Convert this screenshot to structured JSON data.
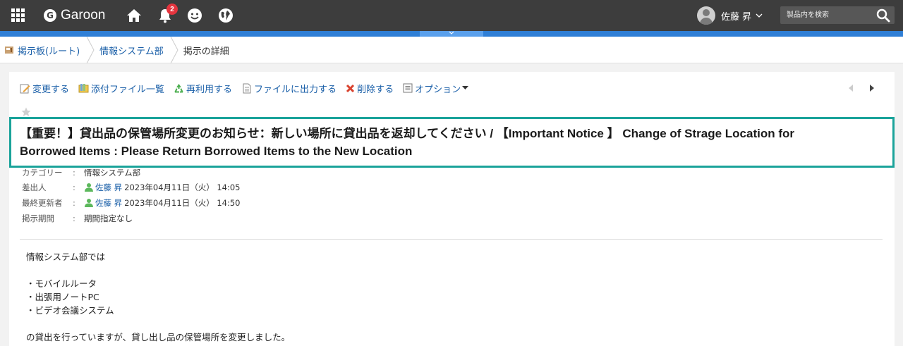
{
  "header": {
    "app_name": "Garoon",
    "logo_letter": "G",
    "notification_count": "2",
    "user_name": "佐藤 昇",
    "search_placeholder": "製品内を検索"
  },
  "breadcrumb": {
    "items": [
      "掲示板(ルート)",
      "情報システム部"
    ],
    "current": "掲示の詳細"
  },
  "toolbar": {
    "edit": "変更する",
    "attachments": "添付ファイル一覧",
    "reuse": "再利用する",
    "export": "ファイルに出力する",
    "delete": "削除する",
    "options": "オプション"
  },
  "post": {
    "title_line1": "【重要！】貸出品の保管場所変更のお知らせ：新しい場所に貸出品を返却してください / 【Important Notice 】 Change of Strage Location for",
    "title_line2": "Borrowed Items : Please Return Borrowed Items to the New Location",
    "category_label": "カテゴリー",
    "category_value": "情報システム部",
    "sender_label": "差出人",
    "sender_name": "佐藤 昇",
    "sender_time": "2023年04月11日（火） 14:05",
    "updater_label": "最終更新者",
    "updater_name": "佐藤 昇",
    "updater_time": "2023年04月11日（火） 14:50",
    "period_label": "掲示期間",
    "period_value": "期間指定なし",
    "colon": ":"
  },
  "body": {
    "line1": "情報システム部では",
    "bullet1": "・モバイルルータ",
    "bullet2": "・出張用ノートPC",
    "bullet3": "・ビデオ会議システム",
    "line2": "の貸出を行っていますが、貸し出し品の保管場所を変更しました。"
  },
  "colors": {
    "topbar": "#3d3d3d",
    "accent_blue": "#2f7fd6",
    "link": "#1a5fa8",
    "highlight_border": "#1aa39a",
    "badge": "#e5343e"
  }
}
